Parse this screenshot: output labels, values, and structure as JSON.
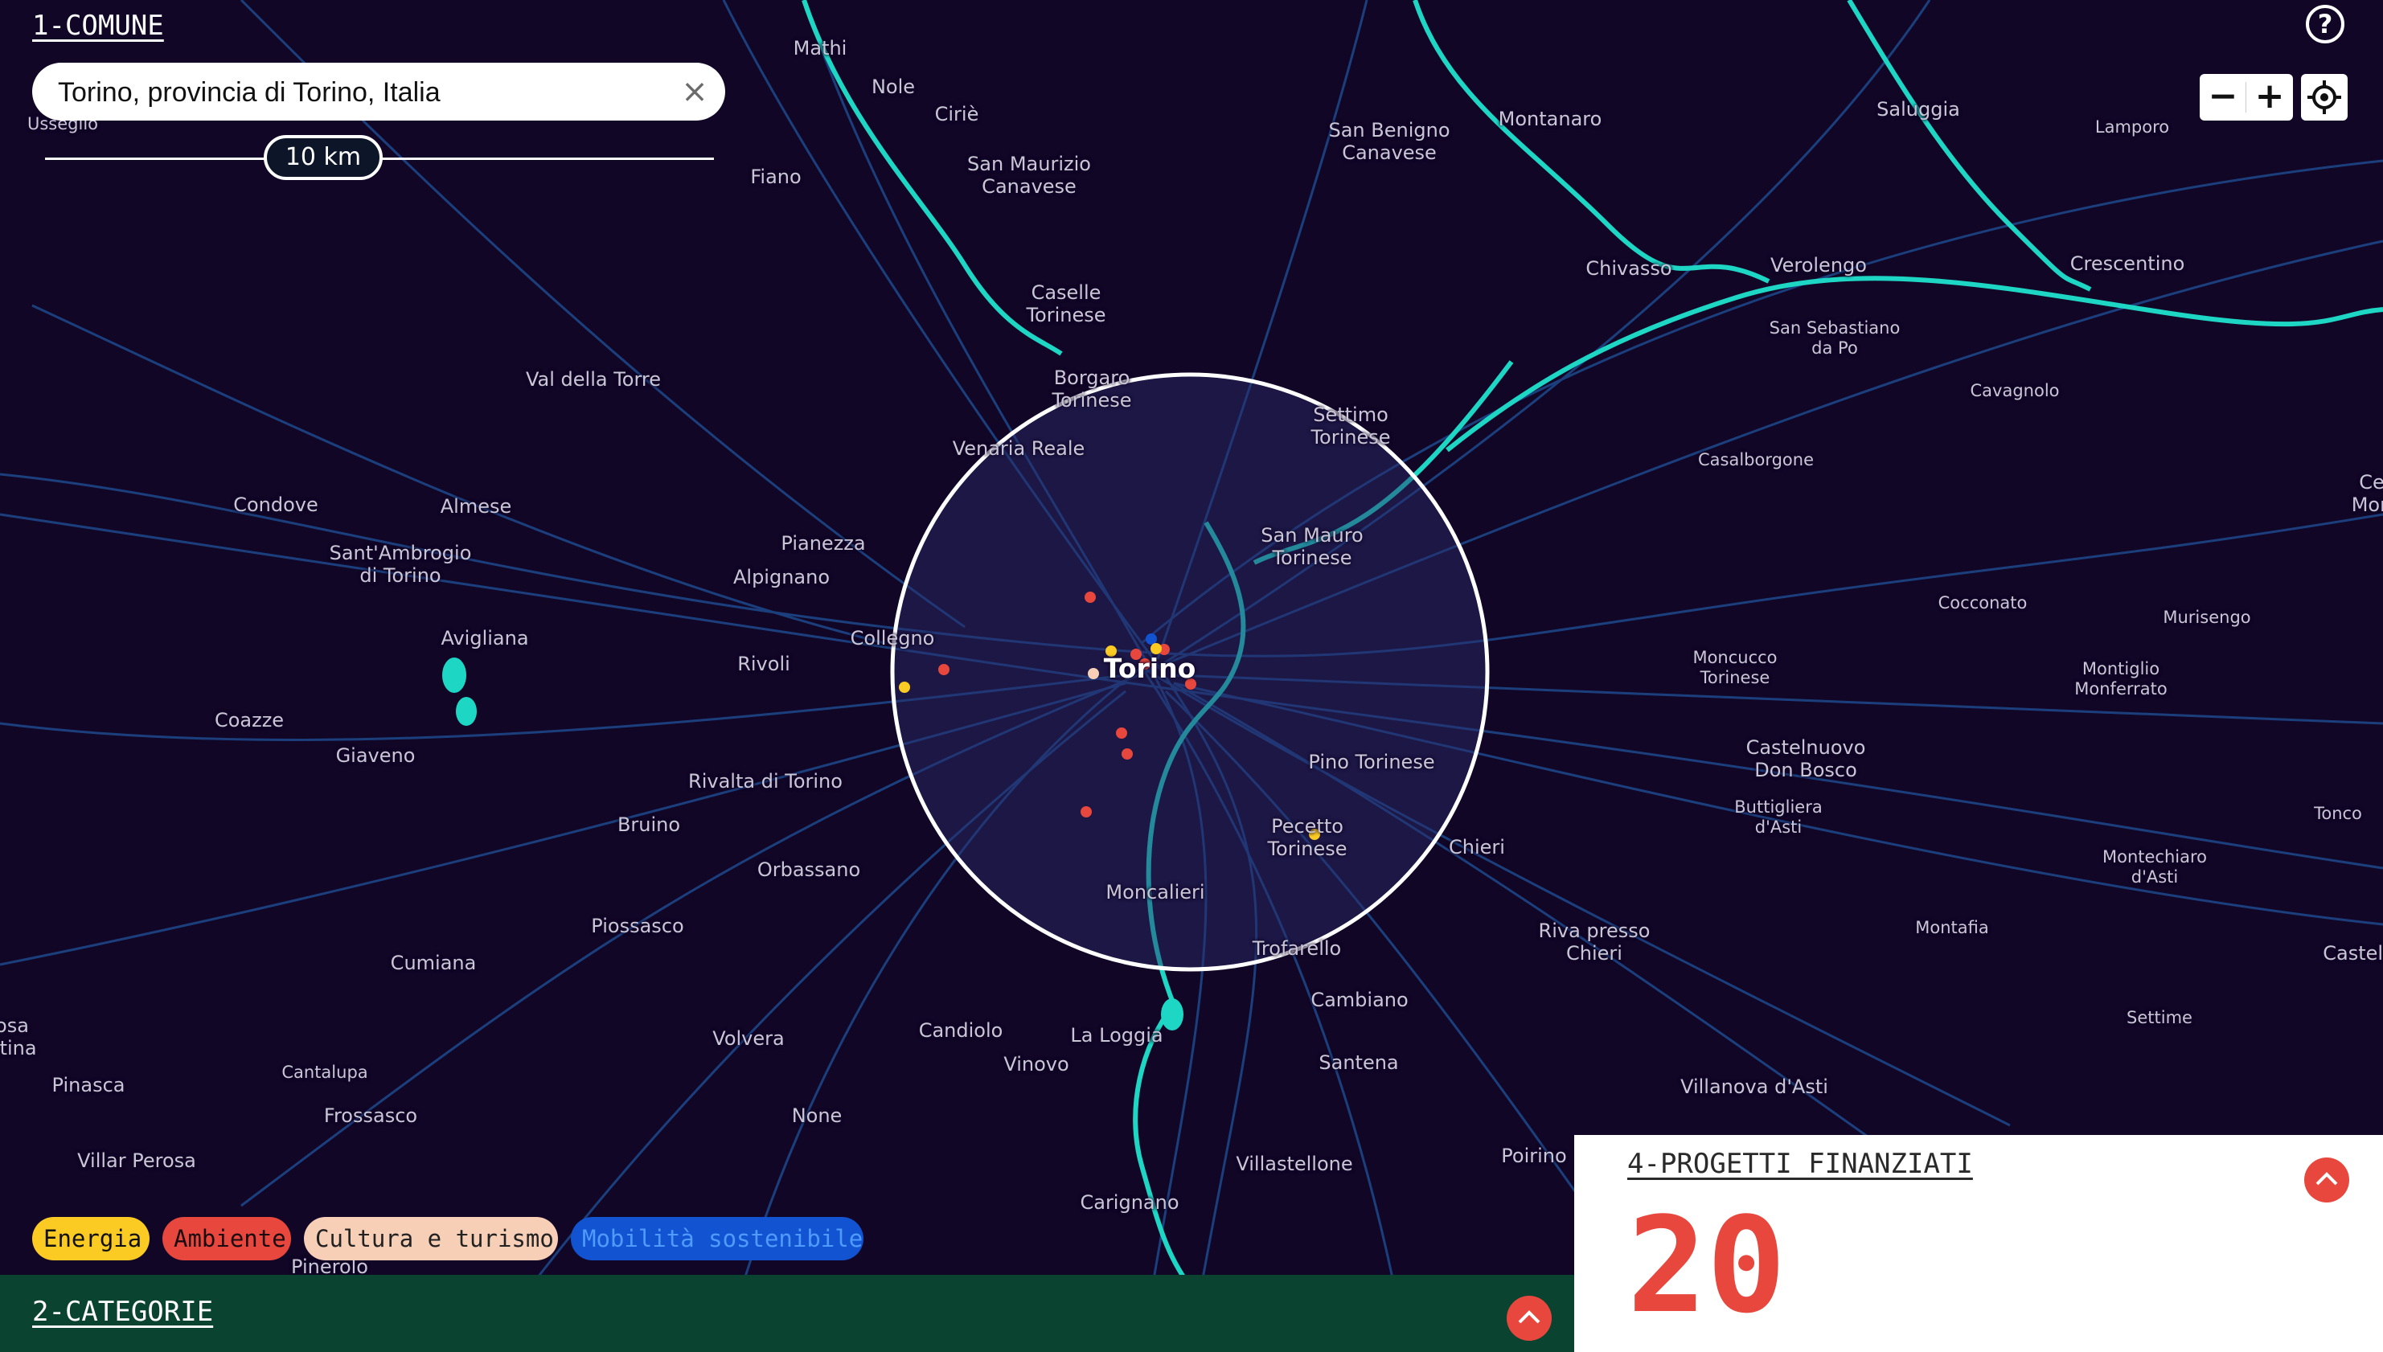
{
  "comune": {
    "title": "1-COMUNE",
    "search_value": "Torino, provincia di Torino, Italia",
    "radius_label": "10 km"
  },
  "map": {
    "water_color": "#1ed6c4",
    "road_color": "#1d4a8c",
    "background_color": "#120627",
    "place_labels": [
      "Usseglio",
      "Mathi",
      "Nole",
      "Ciriè",
      "Fiano",
      "San Maurizio\nCanavese",
      "San Benigno\nCanavese",
      "Montanaro",
      "Saluggia",
      "Lamporo",
      "Chivasso",
      "Verolengo",
      "Crescentino",
      "San Sebastiano\nda Po",
      "Caselle\nTorinese",
      "Borgaro\nTorinese",
      "Venaria Reale",
      "Settimo\nTorinese",
      "Val della Torre",
      "Cavagnolo",
      "Casalborgone",
      "Condove",
      "Almese",
      "Sant'Ambrogio\ndi Torino",
      "Pianezza",
      "Alpignano",
      "San Mauro\nTorinese",
      "Collegno",
      "Avigliana",
      "Rivoli",
      "Cocconato",
      "Murisengo",
      "Moncucco\nTorinese",
      "Montiglio\nMonferrato",
      "Coazze",
      "Giaveno",
      "Castelnuovo\nDon Bosco",
      "Pino Torinese",
      "Rivalta di Torino",
      "Buttigliera\nd'Asti",
      "Tonco",
      "Bruino",
      "Pecetto\nTorinese",
      "Chieri",
      "Orbassano",
      "Montechiaro\nd'Asti",
      "Piossasco",
      "Moncalieri",
      "Riva presso\nChieri",
      "Montafia",
      "Castell",
      "Cumiana",
      "Trofarello",
      "Cambiano",
      "Settime",
      "Cantalupa",
      "Volvera",
      "Candiolo",
      "La Loggia",
      "Vinovo",
      "Santena",
      "Frossasco",
      "Pinasca",
      "Villanova d'Asti",
      "None",
      "Villar Perosa",
      "Villastellone",
      "Poirino",
      "Carignano",
      "Pinerolo",
      "osa\nntina",
      "Ce\nMon"
    ],
    "city_label": "Torino"
  },
  "controls": {
    "help_icon": "question-circle-icon",
    "zoom_out": "−",
    "zoom_in": "+",
    "locate_icon": "crosshair-icon"
  },
  "categories": {
    "title": "2-CATEGORIE",
    "chips": [
      {
        "label": "Energia",
        "color": "#fbcb24"
      },
      {
        "label": "Ambiente",
        "color": "#e8473d"
      },
      {
        "label": "Cultura e turismo",
        "color": "#f7cfb7"
      },
      {
        "label": "Mobilità sostenibile",
        "color": "#1253d1"
      }
    ],
    "toggle_icon": "chevron-up-icon"
  },
  "projects": {
    "title": "4-PROGETTI FINANZIATI",
    "count": "20",
    "toggle_icon": "chevron-up-icon"
  }
}
